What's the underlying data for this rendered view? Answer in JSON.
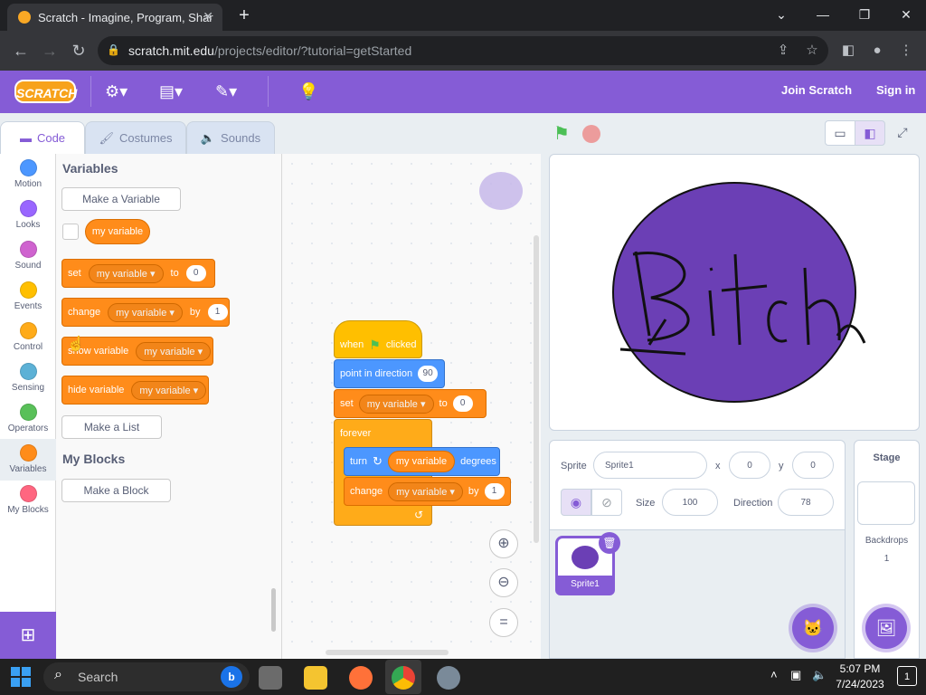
{
  "browser": {
    "tab_title": "Scratch - Imagine, Program, Shar",
    "url_domain": "scratch.mit.edu",
    "url_path": "/projects/editor/?tutorial=getStarted"
  },
  "menu": {
    "logo": "SCRATCH",
    "join": "Join Scratch",
    "signin": "Sign in"
  },
  "editor_tabs": [
    "Code",
    "Costumes",
    "Sounds"
  ],
  "categories": [
    {
      "label": "Motion",
      "color": "#4c97ff"
    },
    {
      "label": "Looks",
      "color": "#9966ff"
    },
    {
      "label": "Sound",
      "color": "#cf63cf"
    },
    {
      "label": "Events",
      "color": "#ffbf00"
    },
    {
      "label": "Control",
      "color": "#ffab19"
    },
    {
      "label": "Sensing",
      "color": "#5cb1d6"
    },
    {
      "label": "Operators",
      "color": "#59c059"
    },
    {
      "label": "Variables",
      "color": "#ff8c1a"
    },
    {
      "label": "My Blocks",
      "color": "#ff6680"
    }
  ],
  "palette": {
    "variables_heading": "Variables",
    "make_variable": "Make a Variable",
    "my_variable": "my variable",
    "set_block": {
      "op": "set",
      "var": "my variable",
      "to": "to",
      "value": "0"
    },
    "change_block": {
      "op": "change",
      "var": "my variable",
      "by": "by",
      "value": "1"
    },
    "show_block": {
      "op": "show variable",
      "var": "my variable"
    },
    "hide_block": {
      "op": "hide variable",
      "var": "my variable"
    },
    "make_list": "Make a List",
    "myblocks_heading": "My Blocks",
    "make_block": "Make a Block"
  },
  "script": {
    "when_flag": {
      "when": "when",
      "clicked": "clicked"
    },
    "point": {
      "label": "point in direction",
      "value": "90"
    },
    "set": {
      "op": "set",
      "var": "my variable",
      "to": "to",
      "value": "0"
    },
    "forever": "forever",
    "turn": {
      "label": "turn",
      "var": "my variable",
      "suffix": "degrees"
    },
    "change": {
      "op": "change",
      "var": "my variable",
      "by": "by",
      "value": "1"
    }
  },
  "stage": {
    "drawing_text": "Bitch",
    "circle_color": "#6b3fb5"
  },
  "sprite_info": {
    "sprite_label": "Sprite",
    "sprite_name": "Sprite1",
    "x_label": "x",
    "x": "0",
    "y_label": "y",
    "y": "0",
    "size_label": "Size",
    "size": "100",
    "direction_label": "Direction",
    "direction": "78"
  },
  "sprite_list": [
    {
      "name": "Sprite1"
    }
  ],
  "stage_panel": {
    "heading": "Stage",
    "backdrops_label": "Backdrops",
    "backdrops_count": "1"
  },
  "taskbar": {
    "search": "Search",
    "time": "5:07 PM",
    "date": "7/24/2023",
    "notif": "1"
  }
}
